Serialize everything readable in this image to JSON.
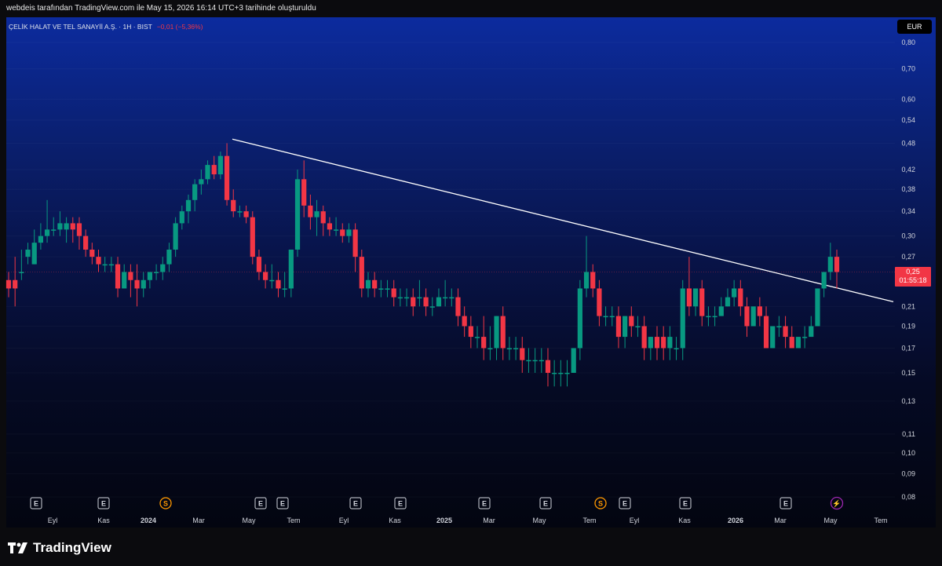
{
  "header": {
    "attribution": "webdeis tarafından TradingView.com ile May 15, 2026 16:14 UTC+3 tarihinde oluşturuldu"
  },
  "legend": {
    "symbol": "ÇELİK HALAT VE TEL SANAYİİ A.Ş. · 1H · BIST",
    "change": "−0,01 (−5,36%)"
  },
  "currency_button": "EUR",
  "price_tag": {
    "price": "0,25",
    "countdown": "01:55:18"
  },
  "brand": {
    "name": "TradingView"
  },
  "colors": {
    "up": "#089981",
    "down": "#f23645",
    "trendline": "#ffffff"
  },
  "chart_data": {
    "type": "candlestick",
    "scale": "log",
    "ylim": [
      0.075,
      0.85
    ],
    "y_ticks": [
      "0,80",
      "0,70",
      "0,60",
      "0,54",
      "0,48",
      "0,42",
      "0,38",
      "0,34",
      "0,30",
      "0,27",
      "0,21",
      "0,19",
      "0,17",
      "0,15",
      "0,13",
      "0,11",
      "0,10",
      "0,09",
      "0,08"
    ],
    "x_ticks": [
      "Eyl",
      "Kas",
      "2024",
      "Mar",
      "May",
      "Tem",
      "Eyl",
      "Kas",
      "2025",
      "Mar",
      "May",
      "Tem",
      "Eyl",
      "Kas",
      "2026",
      "Mar",
      "May",
      "Tem"
    ],
    "events": [
      "E",
      "E",
      "S",
      "E",
      "E",
      "E",
      "E",
      "E",
      "E",
      "S",
      "E",
      "E",
      "E",
      "⚡"
    ],
    "last_price": 0.25,
    "trendline": {
      "start": {
        "date": "2024-04",
        "price": 0.49
      },
      "through": {
        "date": "2025-07",
        "price": 0.31
      },
      "end": {
        "date": "2026-07",
        "price": 0.215
      }
    },
    "candles": [
      [
        0.24,
        0.25,
        0.23,
        0.22
      ],
      [
        0.24,
        0.27,
        0.23,
        0.21
      ],
      [
        0.25,
        0.28,
        0.25,
        0.24
      ],
      [
        0.27,
        0.29,
        0.28,
        0.26
      ],
      [
        0.26,
        0.31,
        0.29,
        0.26
      ],
      [
        0.29,
        0.32,
        0.3,
        0.28
      ],
      [
        0.3,
        0.36,
        0.31,
        0.29
      ],
      [
        0.31,
        0.33,
        0.31,
        0.3
      ],
      [
        0.31,
        0.34,
        0.32,
        0.3
      ],
      [
        0.31,
        0.33,
        0.32,
        0.29
      ],
      [
        0.32,
        0.33,
        0.31,
        0.29
      ],
      [
        0.32,
        0.33,
        0.3,
        0.28
      ],
      [
        0.3,
        0.31,
        0.28,
        0.27
      ],
      [
        0.28,
        0.29,
        0.27,
        0.26
      ],
      [
        0.27,
        0.28,
        0.26,
        0.25
      ],
      [
        0.26,
        0.27,
        0.26,
        0.25
      ],
      [
        0.26,
        0.27,
        0.26,
        0.25
      ],
      [
        0.26,
        0.27,
        0.23,
        0.22
      ],
      [
        0.23,
        0.26,
        0.25,
        0.23
      ],
      [
        0.25,
        0.26,
        0.24,
        0.22
      ],
      [
        0.24,
        0.26,
        0.23,
        0.21
      ],
      [
        0.23,
        0.25,
        0.24,
        0.22
      ],
      [
        0.24,
        0.25,
        0.25,
        0.23
      ],
      [
        0.25,
        0.26,
        0.25,
        0.24
      ],
      [
        0.25,
        0.27,
        0.26,
        0.24
      ],
      [
        0.26,
        0.29,
        0.28,
        0.25
      ],
      [
        0.28,
        0.33,
        0.32,
        0.27
      ],
      [
        0.32,
        0.35,
        0.34,
        0.31
      ],
      [
        0.34,
        0.37,
        0.36,
        0.32
      ],
      [
        0.36,
        0.4,
        0.39,
        0.34
      ],
      [
        0.39,
        0.42,
        0.4,
        0.37
      ],
      [
        0.4,
        0.44,
        0.43,
        0.39
      ],
      [
        0.43,
        0.45,
        0.41,
        0.4
      ],
      [
        0.41,
        0.46,
        0.45,
        0.4
      ],
      [
        0.45,
        0.48,
        0.36,
        0.35
      ],
      [
        0.36,
        0.38,
        0.34,
        0.33
      ],
      [
        0.34,
        0.35,
        0.34,
        0.33
      ],
      [
        0.34,
        0.35,
        0.33,
        0.32
      ],
      [
        0.33,
        0.34,
        0.27,
        0.26
      ],
      [
        0.27,
        0.28,
        0.25,
        0.24
      ],
      [
        0.25,
        0.26,
        0.24,
        0.23
      ],
      [
        0.24,
        0.26,
        0.24,
        0.23
      ],
      [
        0.24,
        0.25,
        0.23,
        0.22
      ],
      [
        0.23,
        0.25,
        0.23,
        0.22
      ],
      [
        0.23,
        0.28,
        0.28,
        0.22
      ],
      [
        0.28,
        0.42,
        0.4,
        0.27
      ],
      [
        0.4,
        0.44,
        0.35,
        0.33
      ],
      [
        0.35,
        0.37,
        0.33,
        0.31
      ],
      [
        0.33,
        0.36,
        0.34,
        0.3
      ],
      [
        0.34,
        0.35,
        0.32,
        0.3
      ],
      [
        0.32,
        0.33,
        0.31,
        0.3
      ],
      [
        0.31,
        0.33,
        0.31,
        0.3
      ],
      [
        0.31,
        0.32,
        0.3,
        0.29
      ],
      [
        0.3,
        0.32,
        0.31,
        0.29
      ],
      [
        0.31,
        0.32,
        0.27,
        0.25
      ],
      [
        0.27,
        0.28,
        0.23,
        0.22
      ],
      [
        0.23,
        0.25,
        0.24,
        0.22
      ],
      [
        0.24,
        0.25,
        0.23,
        0.22
      ],
      [
        0.23,
        0.24,
        0.23,
        0.22
      ],
      [
        0.23,
        0.24,
        0.23,
        0.22
      ],
      [
        0.23,
        0.24,
        0.22,
        0.21
      ],
      [
        0.22,
        0.23,
        0.22,
        0.21
      ],
      [
        0.22,
        0.23,
        0.22,
        0.21
      ],
      [
        0.22,
        0.23,
        0.21,
        0.2
      ],
      [
        0.22,
        0.24,
        0.22,
        0.21
      ],
      [
        0.22,
        0.23,
        0.21,
        0.2
      ],
      [
        0.21,
        0.22,
        0.21,
        0.2
      ],
      [
        0.21,
        0.23,
        0.22,
        0.21
      ],
      [
        0.22,
        0.24,
        0.22,
        0.21
      ],
      [
        0.22,
        0.23,
        0.22,
        0.21
      ],
      [
        0.22,
        0.23,
        0.2,
        0.19
      ],
      [
        0.2,
        0.21,
        0.19,
        0.18
      ],
      [
        0.19,
        0.2,
        0.18,
        0.17
      ],
      [
        0.18,
        0.19,
        0.18,
        0.17
      ],
      [
        0.18,
        0.2,
        0.17,
        0.16
      ],
      [
        0.17,
        0.19,
        0.17,
        0.16
      ],
      [
        0.17,
        0.2,
        0.2,
        0.16
      ],
      [
        0.2,
        0.21,
        0.17,
        0.16
      ],
      [
        0.17,
        0.18,
        0.17,
        0.16
      ],
      [
        0.17,
        0.18,
        0.17,
        0.16
      ],
      [
        0.17,
        0.18,
        0.16,
        0.15
      ],
      [
        0.16,
        0.17,
        0.16,
        0.15
      ],
      [
        0.16,
        0.17,
        0.16,
        0.15
      ],
      [
        0.16,
        0.17,
        0.16,
        0.15
      ],
      [
        0.16,
        0.17,
        0.15,
        0.14
      ],
      [
        0.15,
        0.16,
        0.15,
        0.14
      ],
      [
        0.15,
        0.16,
        0.15,
        0.14
      ],
      [
        0.15,
        0.16,
        0.15,
        0.14
      ],
      [
        0.15,
        0.17,
        0.17,
        0.15
      ],
      [
        0.17,
        0.24,
        0.23,
        0.16
      ],
      [
        0.23,
        0.3,
        0.25,
        0.22
      ],
      [
        0.25,
        0.26,
        0.23,
        0.22
      ],
      [
        0.23,
        0.24,
        0.2,
        0.19
      ],
      [
        0.2,
        0.21,
        0.2,
        0.19
      ],
      [
        0.2,
        0.21,
        0.2,
        0.19
      ],
      [
        0.2,
        0.21,
        0.18,
        0.17
      ],
      [
        0.18,
        0.2,
        0.2,
        0.17
      ],
      [
        0.2,
        0.21,
        0.19,
        0.18
      ],
      [
        0.19,
        0.2,
        0.19,
        0.18
      ],
      [
        0.19,
        0.2,
        0.17,
        0.16
      ],
      [
        0.17,
        0.18,
        0.18,
        0.16
      ],
      [
        0.18,
        0.19,
        0.17,
        0.16
      ],
      [
        0.18,
        0.19,
        0.17,
        0.16
      ],
      [
        0.17,
        0.19,
        0.18,
        0.16
      ],
      [
        0.17,
        0.18,
        0.17,
        0.16
      ],
      [
        0.17,
        0.24,
        0.23,
        0.16
      ],
      [
        0.23,
        0.27,
        0.21,
        0.2
      ],
      [
        0.21,
        0.23,
        0.23,
        0.2
      ],
      [
        0.23,
        0.24,
        0.2,
        0.19
      ],
      [
        0.2,
        0.21,
        0.2,
        0.19
      ],
      [
        0.2,
        0.21,
        0.2,
        0.19
      ],
      [
        0.2,
        0.22,
        0.21,
        0.2
      ],
      [
        0.21,
        0.23,
        0.22,
        0.21
      ],
      [
        0.22,
        0.24,
        0.23,
        0.21
      ],
      [
        0.23,
        0.24,
        0.21,
        0.2
      ],
      [
        0.21,
        0.22,
        0.19,
        0.18
      ],
      [
        0.19,
        0.2,
        0.21,
        0.19
      ],
      [
        0.21,
        0.22,
        0.2,
        0.19
      ],
      [
        0.2,
        0.21,
        0.17,
        0.17
      ],
      [
        0.17,
        0.18,
        0.19,
        0.17
      ],
      [
        0.19,
        0.2,
        0.19,
        0.18
      ],
      [
        0.19,
        0.2,
        0.18,
        0.17
      ],
      [
        0.18,
        0.19,
        0.17,
        0.17
      ],
      [
        0.17,
        0.18,
        0.18,
        0.17
      ],
      [
        0.18,
        0.19,
        0.18,
        0.17
      ],
      [
        0.18,
        0.2,
        0.19,
        0.18
      ],
      [
        0.19,
        0.23,
        0.23,
        0.19
      ],
      [
        0.23,
        0.25,
        0.25,
        0.22
      ],
      [
        0.25,
        0.29,
        0.27,
        0.24
      ],
      [
        0.27,
        0.28,
        0.25,
        0.23
      ]
    ]
  }
}
